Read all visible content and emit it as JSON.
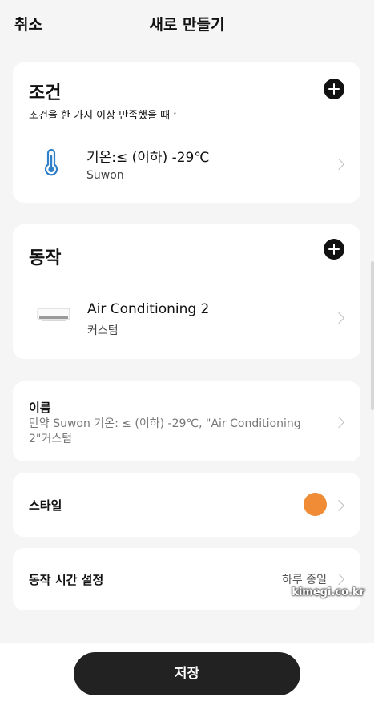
{
  "header": {
    "cancel_label": "취소",
    "title": "새로 만들기"
  },
  "condition": {
    "title": "조건",
    "subtitle": "조건을 한 가지 이상 만족했을 때",
    "subtitle_caret": "˅",
    "item": {
      "main": "기온:≤ (이하) -29℃",
      "sub": "Suwon",
      "icon": "thermometer-icon"
    }
  },
  "action": {
    "title": "동작",
    "item": {
      "main": "Air Conditioning 2",
      "sub": "커스텀",
      "icon": "air-conditioner-icon"
    }
  },
  "name_section": {
    "label": "이름",
    "value": "만약 Suwon 기온: ≤ (이하) -29℃, \"Air Conditioning 2\"커스텀"
  },
  "style_section": {
    "label": "스타일",
    "color": "#ef8c35"
  },
  "time_section": {
    "label": "동작 시간 설정",
    "value": "하루 종일"
  },
  "watermark": "kimegi.co.kr",
  "footer": {
    "save_label": "저장"
  }
}
